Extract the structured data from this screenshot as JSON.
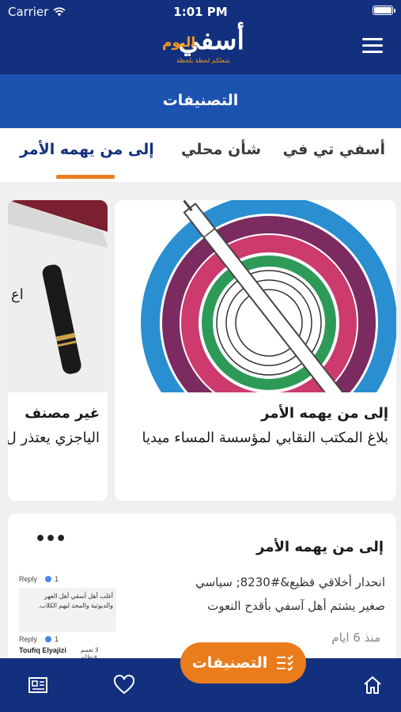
{
  "status_bar": {
    "carrier": "Carrier",
    "time": "1:01 PM"
  },
  "header": {
    "logo_main": "أسفي",
    "logo_accent": "اليوم",
    "logo_tagline": "شعلكم لحظة بلحظة",
    "menu_icon": "hamburger-menu-icon"
  },
  "title_bar": {
    "title": "التصنيفات"
  },
  "tabs": [
    {
      "label": "أسفي تي في"
    },
    {
      "label": "شأن محلي"
    },
    {
      "label": "إلى من يهمه الأمر",
      "active": true
    }
  ],
  "featured_cards": [
    {
      "category": "إلى من يهمه الأمر",
      "headline": "بلاغ المكتب النقابي لمؤسسة المساء ميديا",
      "image": "concentric-circles-pen-illustration"
    },
    {
      "category": "غير مصنف",
      "headline": "الياجزي يعتذر ل",
      "image": "pen-on-paper-photo",
      "image_text": "اع"
    }
  ],
  "list_items": [
    {
      "category": "إلى من يهمه الأمر",
      "title": "انحدار أخلاقي فظيع&#8230; سياسي صغير يشتم أهل آسفي بأقدح النعوت",
      "time": "منذ 6 ايام",
      "more_icon": "more-dots-icon",
      "thumbnail": {
        "reply_label": "Reply",
        "count": "1",
        "text": "أغلب أهل آسفي أهل العهر والديوثية والمحد ليهم الكلاب.",
        "author": "Toufiq Elyajizi",
        "snippet": "لا تعمم فتظلم"
      }
    }
  ],
  "bottom_nav": {
    "home_icon": "home-icon",
    "categories_label": "التصنيفات",
    "categories_icon": "checklist-icon",
    "favorites_icon": "heart-icon",
    "news_icon": "newspaper-icon"
  },
  "colors": {
    "header_blue": "#12307e",
    "title_blue": "#1c52b0",
    "accent_orange": "#ea7c1c"
  }
}
